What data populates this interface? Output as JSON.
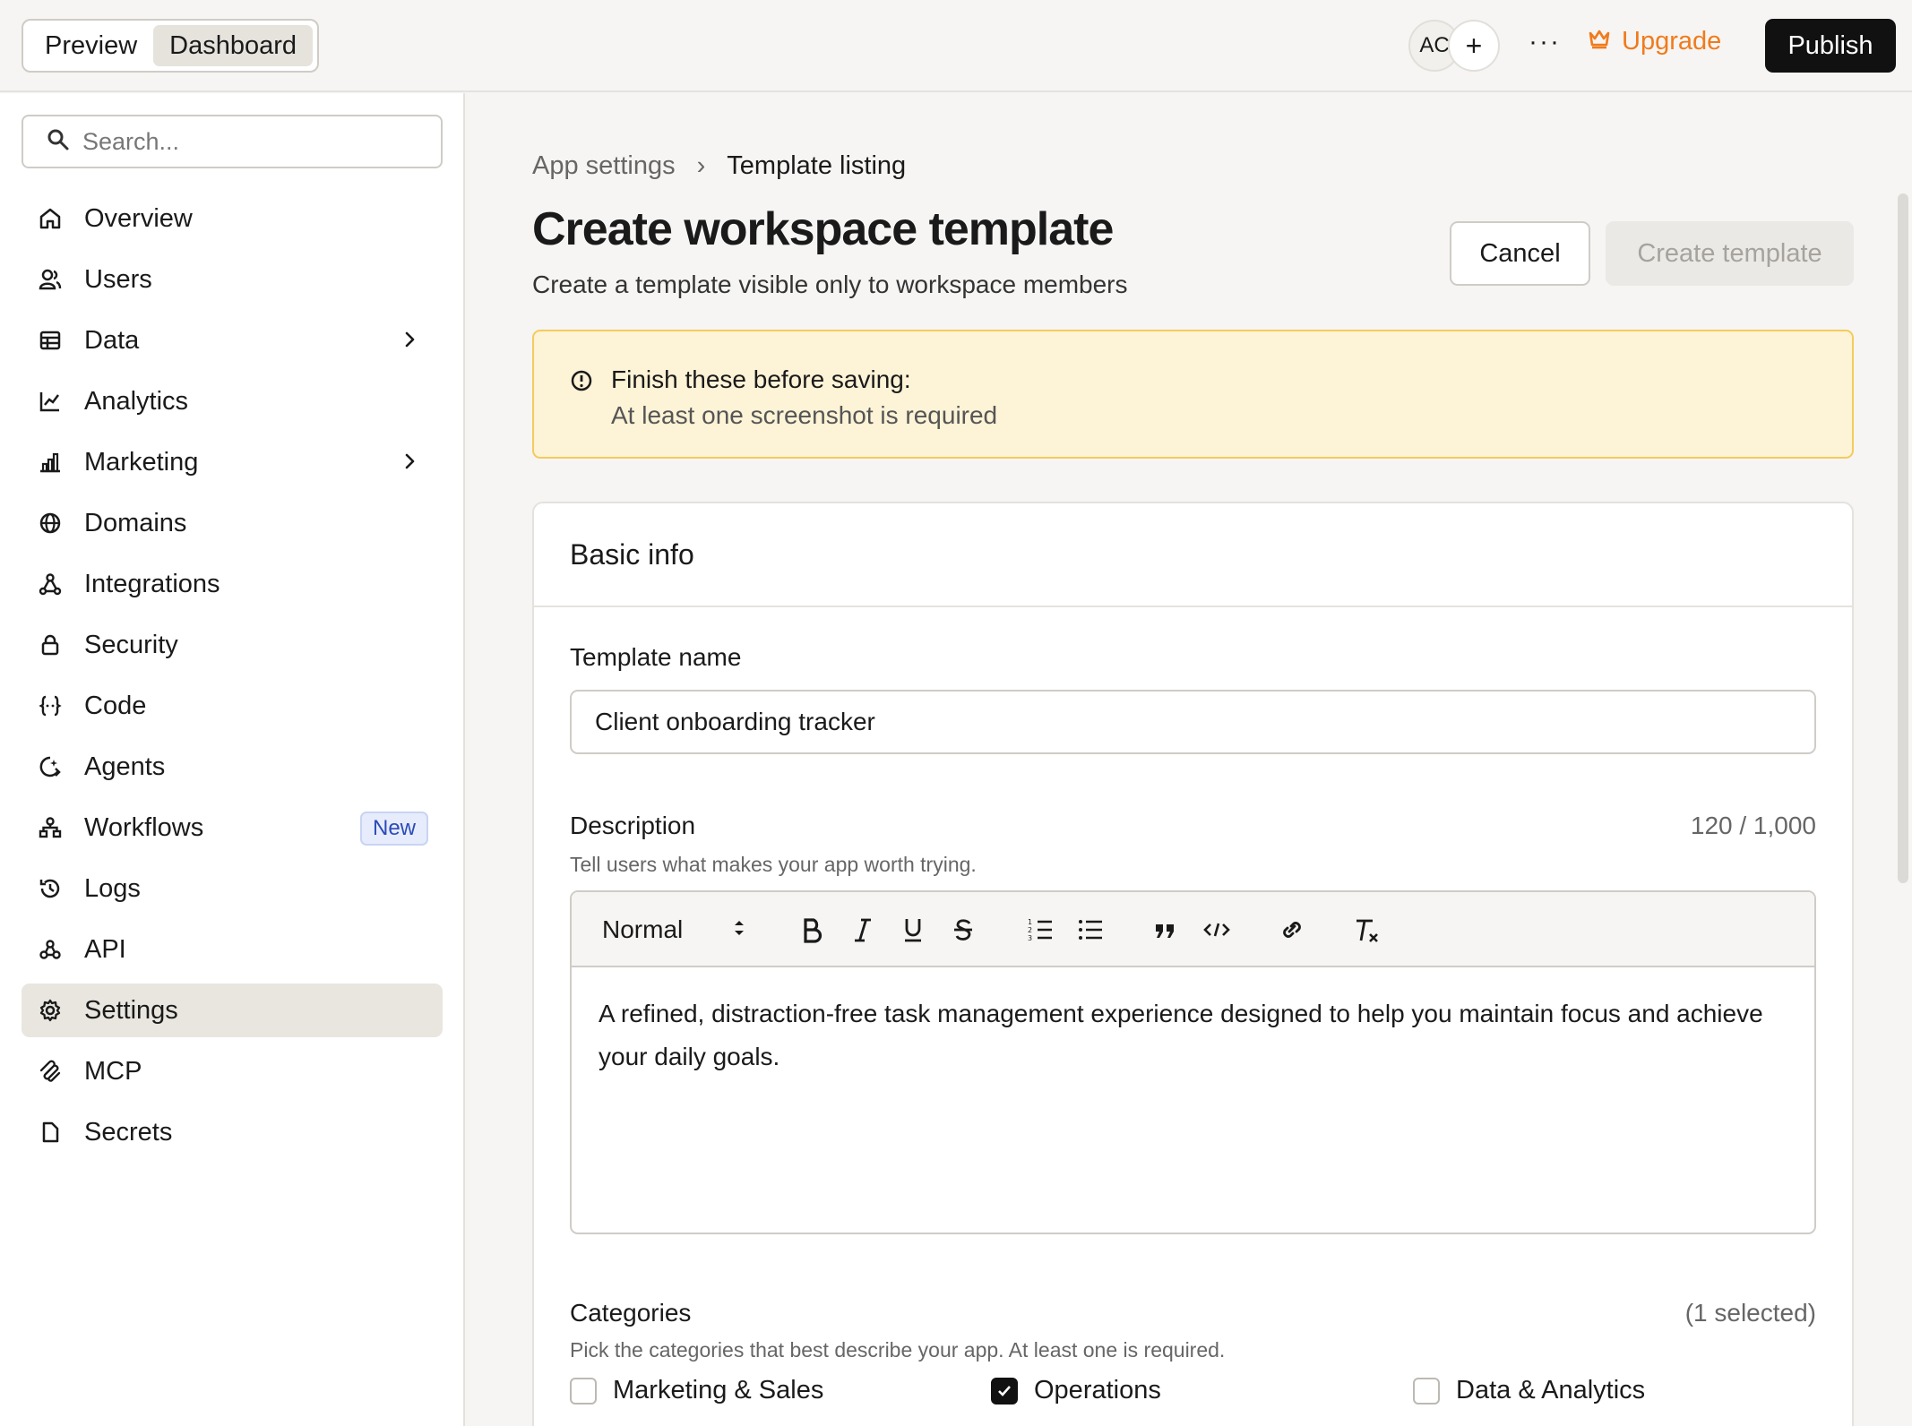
{
  "topbar": {
    "tabs": [
      "Preview",
      "Dashboard"
    ],
    "avatar_initials": "AC",
    "add_symbol": "+",
    "more_symbol": "···",
    "upgrade_label": "Upgrade",
    "publish_label": "Publish",
    "accent_color": "#f07b1c"
  },
  "sidebar": {
    "search_placeholder": "Search...",
    "items": [
      {
        "label": "Overview",
        "icon": "home-icon"
      },
      {
        "label": "Users",
        "icon": "users-icon"
      },
      {
        "label": "Data",
        "icon": "table-icon",
        "chevron": true
      },
      {
        "label": "Analytics",
        "icon": "chart-line-icon"
      },
      {
        "label": "Marketing",
        "icon": "bar-chart-icon",
        "chevron": true
      },
      {
        "label": "Domains",
        "icon": "globe-icon"
      },
      {
        "label": "Integrations",
        "icon": "integrations-icon"
      },
      {
        "label": "Security",
        "icon": "lock-icon"
      },
      {
        "label": "Code",
        "icon": "code-braces-icon"
      },
      {
        "label": "Agents",
        "icon": "agent-icon"
      },
      {
        "label": "Workflows",
        "icon": "workflow-icon",
        "badge": "New"
      },
      {
        "label": "Logs",
        "icon": "history-icon"
      },
      {
        "label": "API",
        "icon": "api-icon"
      },
      {
        "label": "Settings",
        "icon": "gear-icon",
        "active": true
      },
      {
        "label": "MCP",
        "icon": "mcp-icon"
      },
      {
        "label": "Secrets",
        "icon": "file-icon"
      }
    ]
  },
  "main": {
    "breadcrumb": {
      "parent": "App settings",
      "separator": "›",
      "current": "Template listing"
    },
    "title": "Create workspace template",
    "subtitle": "Create a template visible only to workspace members",
    "cancel_label": "Cancel",
    "create_label": "Create template",
    "alert": {
      "title": "Finish these before saving:",
      "message": "At least one screenshot is required"
    },
    "card": {
      "heading": "Basic info",
      "template_name_label": "Template name",
      "template_name_value": "Client onboarding tracker",
      "description_label": "Description",
      "description_hint": "Tell users what makes your app worth trying.",
      "description_counter": "120 / 1,000",
      "editor_format": "Normal",
      "description_text": "A refined, distraction-free task management experience designed to help you maintain focus and achieve your daily goals.",
      "categories_label": "Categories",
      "categories_hint": "Pick the categories that best describe your app. At least one is required.",
      "categories_count": "(1 selected)",
      "categories": [
        {
          "label": "Marketing & Sales",
          "checked": false
        },
        {
          "label": "Operations",
          "checked": true
        },
        {
          "label": "Data & Analytics",
          "checked": false
        }
      ]
    }
  }
}
